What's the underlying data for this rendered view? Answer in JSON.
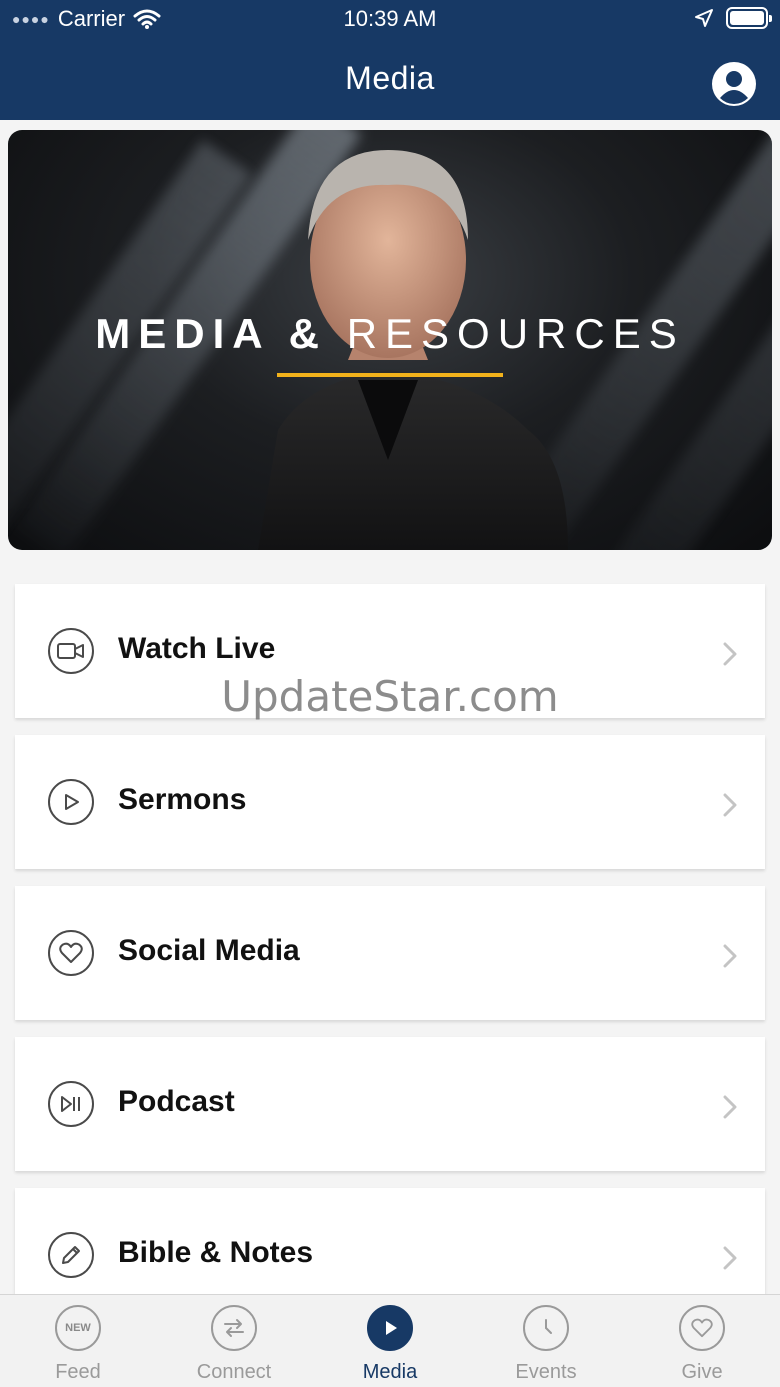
{
  "status_bar": {
    "carrier": "Carrier",
    "time": "10:39 AM"
  },
  "nav": {
    "title": "Media"
  },
  "hero": {
    "title_bold": "MEDIA &",
    "title_light": "RESOURCES",
    "accent_color": "#f2b21b"
  },
  "watermark": "UpdateStar.com",
  "menu": [
    {
      "label": "Watch Live",
      "icon": "video-camera-icon"
    },
    {
      "label": "Sermons",
      "icon": "play-icon"
    },
    {
      "label": "Social Media",
      "icon": "heart-icon"
    },
    {
      "label": "Podcast",
      "icon": "play-pause-icon"
    },
    {
      "label": "Bible & Notes",
      "icon": "pencil-icon"
    }
  ],
  "tabs": [
    {
      "label": "Feed",
      "icon": "new-badge-icon",
      "badge": "NEW"
    },
    {
      "label": "Connect",
      "icon": "swap-arrows-icon"
    },
    {
      "label": "Media",
      "icon": "play-icon",
      "active": true
    },
    {
      "label": "Events",
      "icon": "clock-icon"
    },
    {
      "label": "Give",
      "icon": "heart-icon"
    }
  ],
  "colors": {
    "brand_navy": "#173965",
    "tab_inactive": "#9a9a9a"
  }
}
